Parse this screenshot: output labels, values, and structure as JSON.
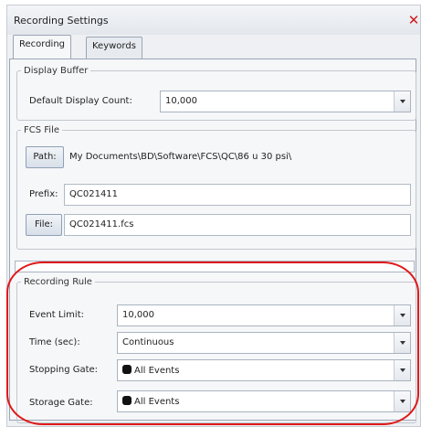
{
  "window": {
    "title": "Recording Settings",
    "close_glyph": "✕",
    "close_icon": "close-icon"
  },
  "tabs": [
    {
      "label": "Recording",
      "active": true
    },
    {
      "label": "Keywords",
      "active": false
    }
  ],
  "display_buffer": {
    "legend": "Display Buffer",
    "default_display_count_label": "Default Display Count:",
    "default_display_count_value": "10,000"
  },
  "fcs_file": {
    "legend": "FCS File",
    "path_button": "Path:",
    "path_value": "My Documents\\BD\\Software\\FCS\\QC\\86 u 30 psi\\",
    "prefix_label": "Prefix:",
    "prefix_value": "QC021411",
    "file_button": "File:",
    "file_value": "QC021411.fcs"
  },
  "recording_progress": 0,
  "recording_rule": {
    "legend": "Recording Rule",
    "event_limit_label": "Event Limit:",
    "event_limit_value": "10,000",
    "time_label": "Time (sec):",
    "time_value": "Continuous",
    "stopping_gate_label": "Stopping Gate:",
    "stopping_gate_value": "All Events",
    "storage_gate_label": "Storage Gate:",
    "storage_gate_value": "All Events",
    "highlight_color": "#e0191a"
  },
  "colors": {
    "window_bg": "#eef0f3",
    "close": "#d21b1b",
    "gate_swatch": "#111111"
  }
}
